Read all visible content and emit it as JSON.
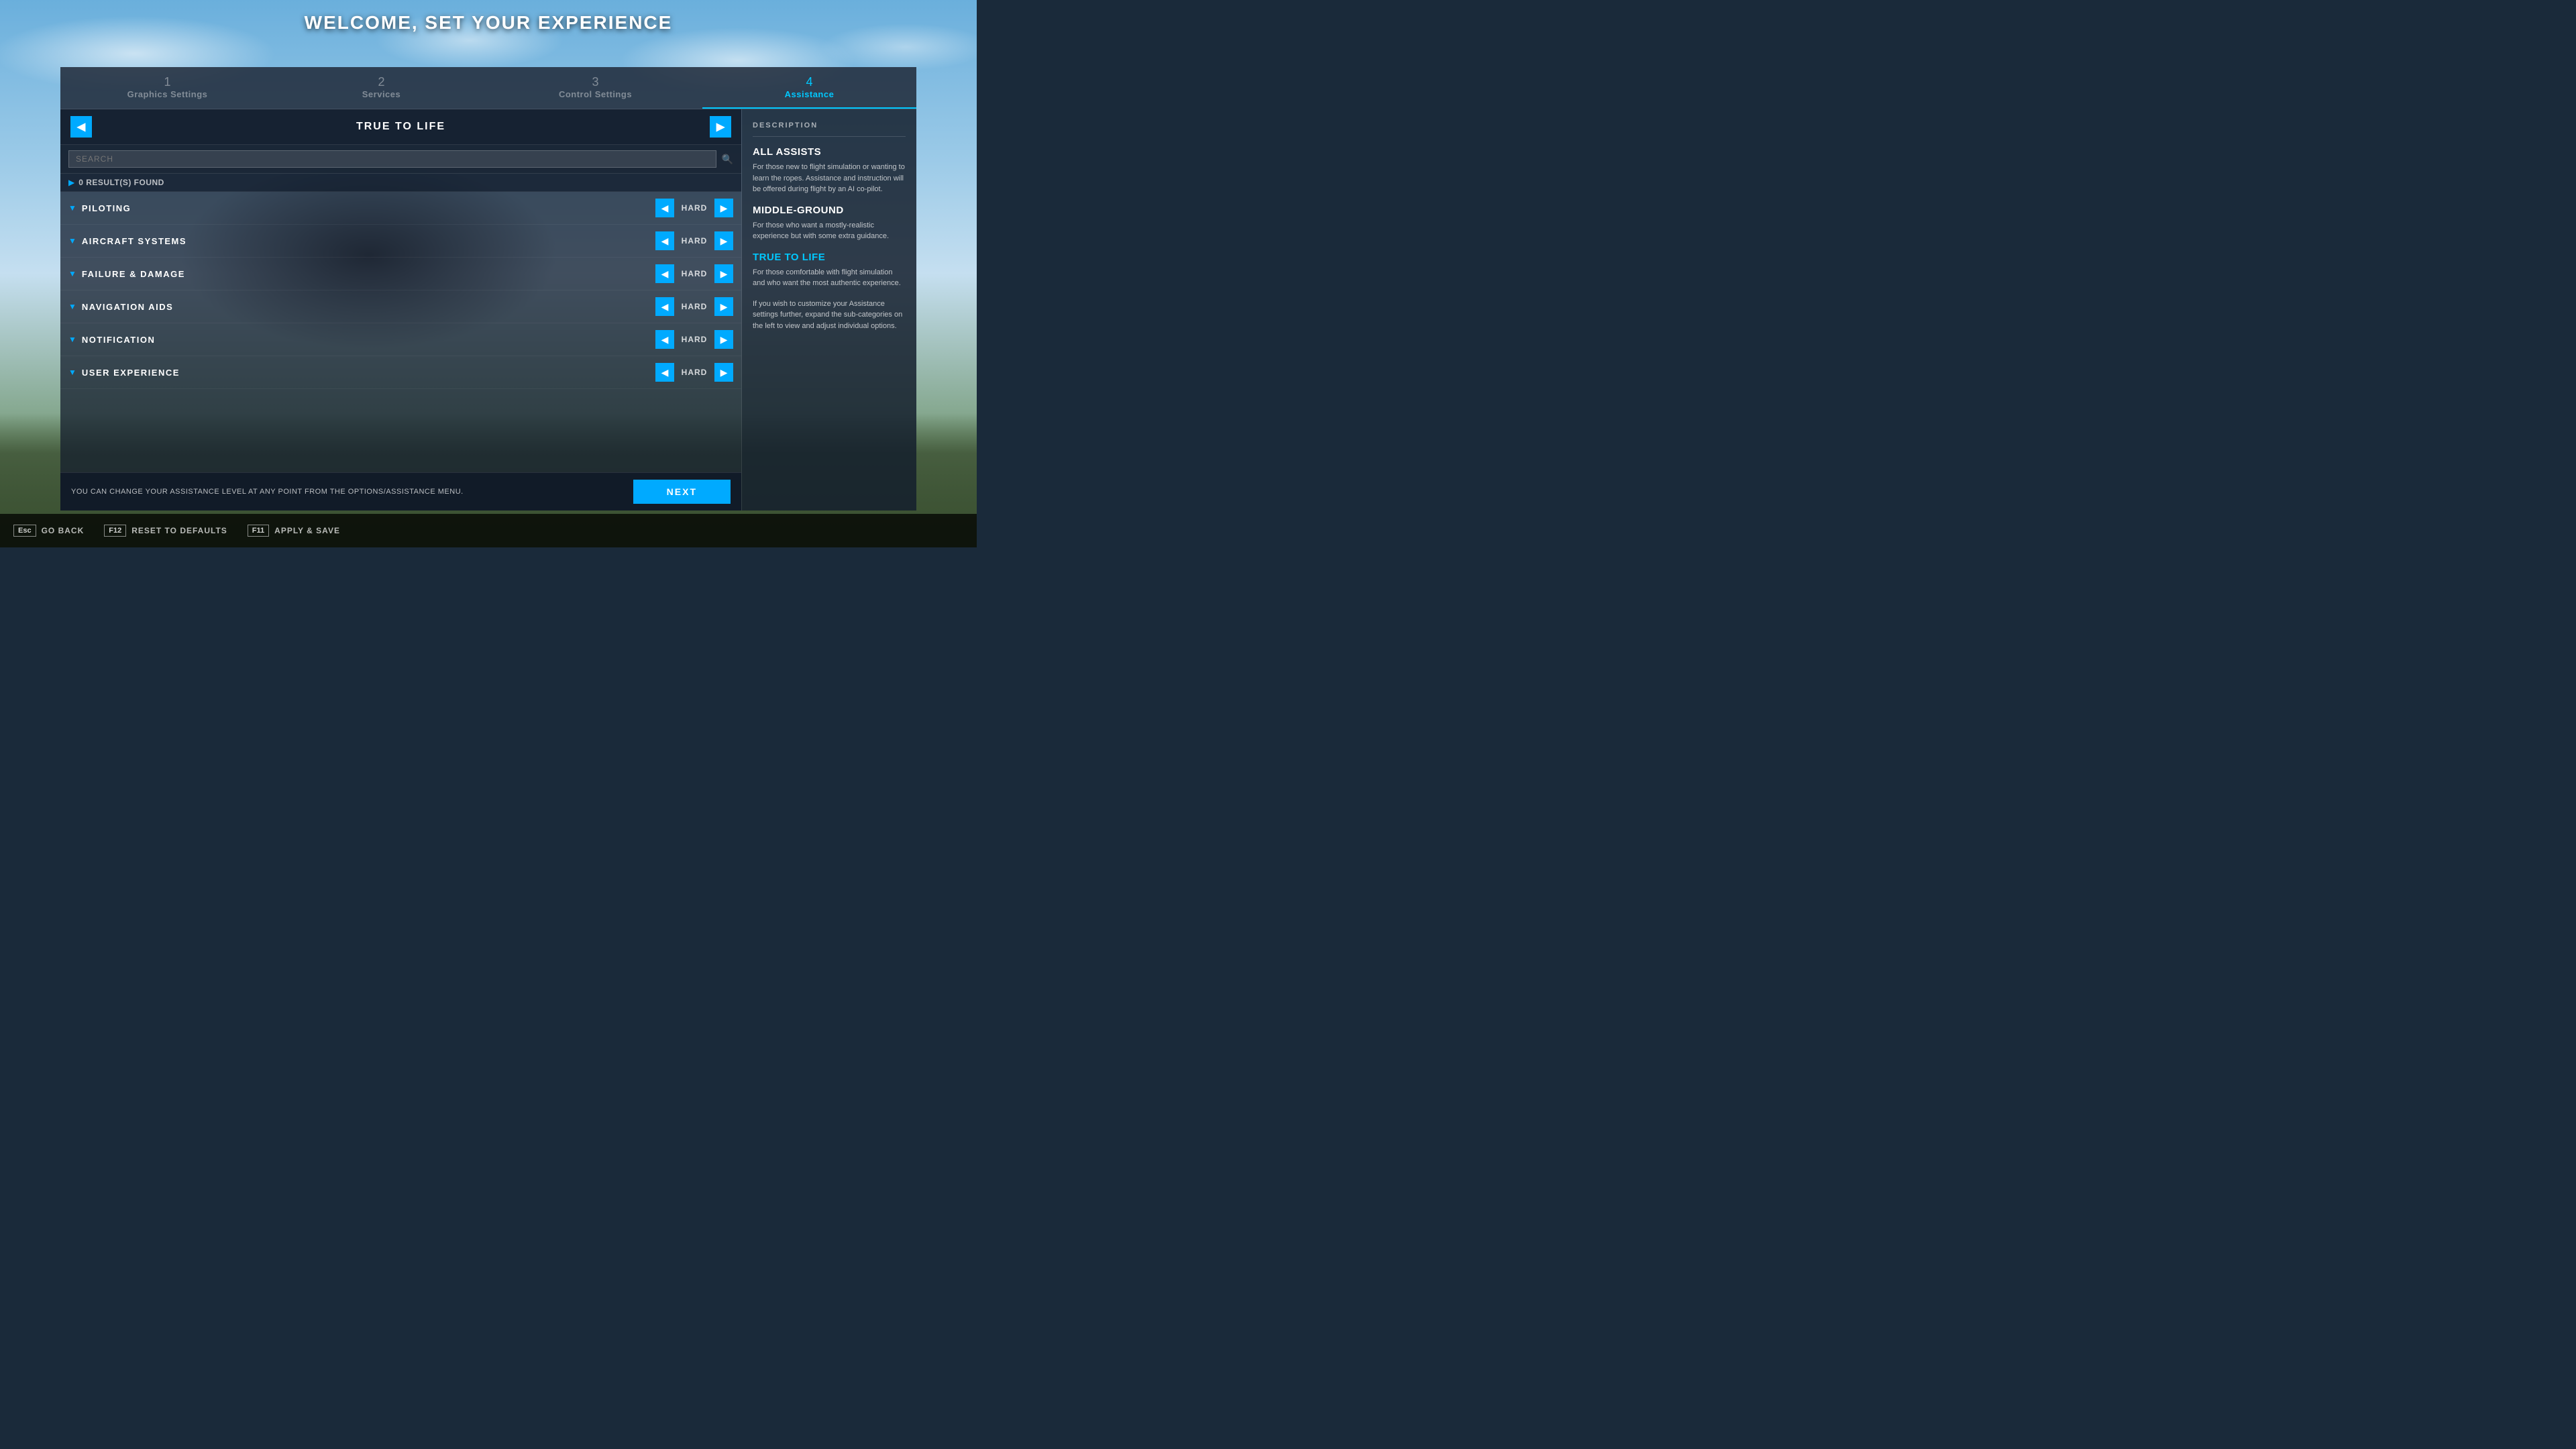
{
  "title": "WELCOME, SET YOUR EXPERIENCE",
  "steps": [
    {
      "num": "1",
      "label": "Graphics Settings",
      "active": false
    },
    {
      "num": "2",
      "label": "Services",
      "active": false
    },
    {
      "num": "3",
      "label": "Control Settings",
      "active": false
    },
    {
      "num": "4",
      "label": "Assistance",
      "active": true
    }
  ],
  "preset": {
    "prev_label": "◀",
    "title": "TRUE TO LIFE",
    "next_label": "▶"
  },
  "search": {
    "placeholder": "SEARCH",
    "results_text": "0 RESULT(S) FOUND"
  },
  "settings": [
    {
      "name": "PILOTING",
      "value": "HARD"
    },
    {
      "name": "AIRCRAFT SYSTEMS",
      "value": "HARD"
    },
    {
      "name": "FAILURE & DAMAGE",
      "value": "HARD"
    },
    {
      "name": "NAVIGATION AIDS",
      "value": "HARD"
    },
    {
      "name": "NOTIFICATION",
      "value": "HARD"
    },
    {
      "name": "USER EXPERIENCE",
      "value": "HARD"
    }
  ],
  "description": {
    "header": "DESCRIPTION",
    "sections": [
      {
        "title": "ALL ASSISTS",
        "body": "For those new to flight simulation or wanting to learn the ropes. Assistance and instruction will be offered during flight by an AI co-pilot."
      },
      {
        "title": "MIDDLE-GROUND",
        "body": "For those who want a mostly-realistic experience but with some extra guidance."
      },
      {
        "title": "TRUE TO LIFE",
        "body": "For those comfortable with flight simulation and who want the most authentic experience.",
        "active": true
      },
      {
        "title": "",
        "body": "If you wish to customize your Assistance settings further, expand the sub-categories on the left to view and adjust individual options."
      }
    ]
  },
  "footer": {
    "note": "YOU CAN CHANGE YOUR ASSISTANCE LEVEL AT ANY POINT FROM THE OPTIONS/ASSISTANCE MENU.",
    "next_label": "NEXT"
  },
  "shortcuts": [
    {
      "key": "Esc",
      "label": "GO BACK"
    },
    {
      "key": "F12",
      "label": "RESET TO DEFAULTS"
    },
    {
      "key": "F11",
      "label": "APPLY & SAVE"
    }
  ]
}
